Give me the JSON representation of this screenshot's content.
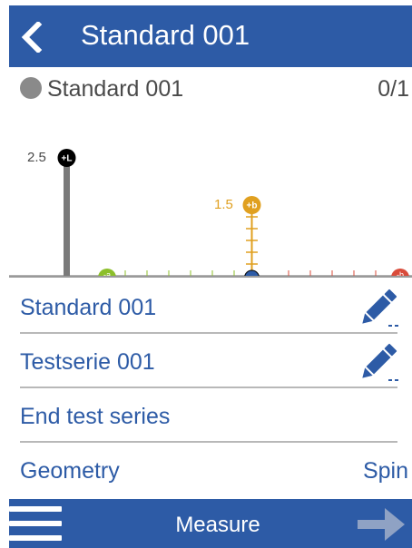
{
  "header": {
    "title": "Standard 001",
    "back_icon": "chevron-left-icon"
  },
  "standard_row": {
    "name": "Standard 001",
    "count": "0/1",
    "dot_color": "#8a8a8a"
  },
  "chart_data": {
    "type": "bar",
    "categories": [
      "+L",
      "+b"
    ],
    "values": [
      2.5,
      1.5
    ],
    "value_labels": [
      "2.5",
      "1.5"
    ],
    "marker_labels": [
      "+L",
      "+b"
    ],
    "colors": [
      "#7a7a7a",
      "#e0a020"
    ],
    "axis_markers": [
      {
        "label": "-a",
        "color": "#8cbf2a"
      },
      {
        "label": "+a",
        "color": "#2d5ba6"
      },
      {
        "label": "-b",
        "color": "#d94b3a"
      }
    ],
    "ylim": [
      0,
      3
    ]
  },
  "menu": [
    {
      "label": "Standard 001",
      "icon": "pencil-icon",
      "value": ""
    },
    {
      "label": "Testserie 001",
      "icon": "pencil-icon",
      "value": ""
    },
    {
      "label": "End test series",
      "icon": "",
      "value": ""
    },
    {
      "label": "Geometry",
      "icon": "",
      "value": "Spin"
    }
  ],
  "footer": {
    "menu_icon": "hamburger-menu-icon",
    "label": "Measure",
    "next_icon": "arrow-right-icon"
  },
  "colors": {
    "primary": "#2d5ba6",
    "text_gray": "#4a4a4a",
    "divider": "#b8b8b8"
  }
}
